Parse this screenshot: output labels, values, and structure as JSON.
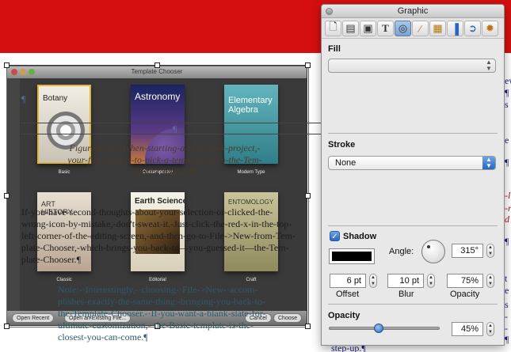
{
  "document": {
    "right_fragments": [
      {
        "text": "ew",
        "color": "blue"
      },
      {
        "text": "¶",
        "color": "blue"
      },
      {
        "text": "s",
        "color": "blue"
      },
      {
        "text": "e",
        "color": "blue"
      },
      {
        "text": "¶",
        "color": "blue"
      },
      {
        "text": "-li",
        "color": "red"
      },
      {
        "text": "-r",
        "color": "red"
      },
      {
        "text": "d",
        "color": "red"
      },
      {
        "text": "¶",
        "color": "blue"
      },
      {
        "text": "t",
        "color": "blue"
      },
      {
        "text": "e",
        "color": "blue"
      },
      {
        "text": "s",
        "color": "blue"
      },
      {
        "text": "-",
        "color": "blue"
      },
      {
        "text": "-",
        "color": "blue"
      },
      {
        "text": "¶",
        "color": "blue"
      }
    ],
    "step_up_text": "step-up.¶",
    "pilcrow": "¶",
    "caption_lines": [
      "Figure-x-xx.:-When-starting-a-new-book-project,-",
      "your-first-step-is-to-pick-a-template-from-the-Tem-",
      "plate-Chooser.¶"
    ],
    "body_lines": [
      "If-you-have-second-thoughts-about-your-selection-or-clicked-the-",
      "wrong-icon-by-mistake,-don't-sweat-it.-Just-click-the-red-x-in-the-top-",
      "left-corner-of-the-editing-screen,-and-then-go-to-File->New-from-Tem-",
      "plate-Chooser,-which-brings-you-back-to—you-guessed-it—the-Tem-",
      "plate-Chooser.¶"
    ],
    "note_lines": [
      "Note:-·Interestingly,-·choosing-·File->New-·accom-",
      "plishes-exactly-the-same-thing:-bringing-you-back-to-",
      "the-Template-Chooser.-·If-you-want-a-blank-slate-for-",
      "ultimate-customization,-·the-Basic-template-is-the-",
      "closest-you-can-come.¶"
    ]
  },
  "template_chooser": {
    "title": "Template Chooser",
    "books": [
      {
        "title": "Botany",
        "label": "Basic"
      },
      {
        "title": "Astronomy",
        "label": "Contemporary"
      },
      {
        "title": "Elementary Algebra",
        "label": "Modern Type"
      },
      {
        "title": "ART HISTORY",
        "label": "Classic"
      },
      {
        "title": "Earth Science",
        "label": "Editorial"
      },
      {
        "title": "ENTOMOLOGY",
        "label": "Craft"
      }
    ],
    "buttons": {
      "open_recent": "Open Recent",
      "open_existing": "Open an Existing File...",
      "cancel": "Cancel",
      "choose": "Choose"
    }
  },
  "inspector": {
    "title": "Graphic",
    "toolbar_icons": [
      "document-icon",
      "layout-icon",
      "wrap-icon",
      "text-icon",
      "graphic-icon",
      "metrics-icon",
      "table-icon",
      "chart-icon",
      "hyperlink-icon",
      "quicktime-icon"
    ],
    "fill": {
      "label": "Fill",
      "value": ""
    },
    "stroke": {
      "label": "Stroke",
      "value": "None"
    },
    "shadow": {
      "label": "Shadow",
      "checked": true,
      "color": "#000000",
      "angle_label": "Angle:",
      "angle": "315°",
      "offset": "6 pt",
      "offset_label": "Offset",
      "blur": "10 pt",
      "blur_label": "Blur",
      "opacity": "75%",
      "opacity_label": "Opacity"
    },
    "opacity": {
      "label": "Opacity",
      "value": "45%",
      "fraction": 0.45
    }
  },
  "colors": {
    "doc_header": "#d50f0f",
    "accent": "#2a64c4"
  }
}
